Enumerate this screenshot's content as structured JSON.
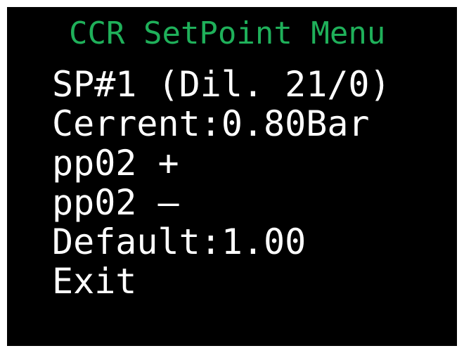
{
  "colors": {
    "background": "#000000",
    "frame": "#ffffff",
    "title": "#1fb05a",
    "item_text": "#ffffff"
  },
  "menu": {
    "title": "CCR SetPoint Menu",
    "items": [
      {
        "label": "SP#1 (Dil. 21/0)"
      },
      {
        "label": "Cerrent:0.80Bar"
      },
      {
        "label": "pp02 +"
      },
      {
        "label": "pp02 —"
      },
      {
        "label": "Default:1.00"
      },
      {
        "label": "Exit"
      }
    ]
  }
}
